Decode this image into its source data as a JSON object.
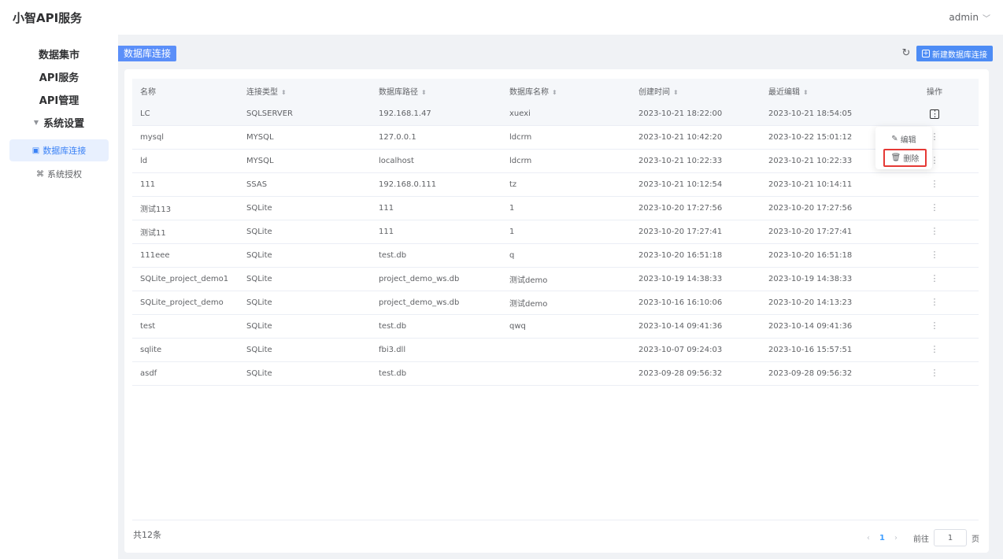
{
  "header": {
    "app_title": "小智API服务",
    "user": "admin",
    "user_chevron": "chevron-down-icon"
  },
  "sidebar": {
    "items": [
      {
        "label": "数据集市"
      },
      {
        "label": "API服务"
      },
      {
        "label": "API管理"
      },
      {
        "label": "系统设置"
      }
    ],
    "sub_items": [
      {
        "label": "数据库连接",
        "icon": "database-icon",
        "active": true
      },
      {
        "label": "系统授权",
        "icon": "authorize-icon",
        "active": false
      }
    ]
  },
  "page": {
    "title": "数据库连接",
    "new_button": "新建数据库连接"
  },
  "table": {
    "columns": [
      "名称",
      "连接类型",
      "数据库路径",
      "数据库名称",
      "创建时间",
      "最近编辑",
      "操作"
    ],
    "rows": [
      [
        "LC",
        "SQLSERVER",
        "192.168.1.47",
        "xuexi",
        "2023-10-21 18:22:00",
        "2023-10-21 18:54:05"
      ],
      [
        "mysql",
        "MYSQL",
        "127.0.0.1",
        "ldcrm",
        "2023-10-21 10:42:20",
        "2023-10-22 15:01:12"
      ],
      [
        "ld",
        "MYSQL",
        "localhost",
        "ldcrm",
        "2023-10-21 10:22:33",
        "2023-10-21 10:22:33"
      ],
      [
        "111",
        "SSAS",
        "192.168.0.111",
        "tz",
        "2023-10-21 10:12:54",
        "2023-10-21 10:14:11"
      ],
      [
        "测试113",
        "SQLite",
        "111",
        "1",
        "2023-10-20 17:27:56",
        "2023-10-20 17:27:56"
      ],
      [
        "测试11",
        "SQLite",
        "111",
        "1",
        "2023-10-20 17:27:41",
        "2023-10-20 17:27:41"
      ],
      [
        "111eee",
        "SQLite",
        "test.db",
        "q",
        "2023-10-20 16:51:18",
        "2023-10-20 16:51:18"
      ],
      [
        "SQLite_project_demo1",
        "SQLite",
        "project_demo_ws.db",
        "测试demo",
        "2023-10-19 14:38:33",
        "2023-10-19 14:38:33"
      ],
      [
        "SQLite_project_demo",
        "SQLite",
        "project_demo_ws.db",
        "测试demo",
        "2023-10-16 16:10:06",
        "2023-10-20 14:13:23"
      ],
      [
        "test",
        "SQLite",
        "test.db",
        "qwq",
        "2023-10-14 09:41:36",
        "2023-10-14 09:41:36"
      ],
      [
        "sqlite",
        "SQLite",
        "fbi3.dll",
        "",
        "2023-10-07 09:24:03",
        "2023-10-16 15:57:51"
      ],
      [
        "asdf",
        "SQLite",
        "test.db",
        "",
        "2023-09-28 09:56:32",
        "2023-09-28 09:56:32"
      ]
    ]
  },
  "dropdown": {
    "edit": "编辑",
    "delete": "删除"
  },
  "pagination": {
    "total": "共12条",
    "current_page": "1",
    "goto_label": "前往",
    "goto_value": "1",
    "page_suffix": "页"
  },
  "colors": {
    "primary": "#4d8cf5",
    "highlight_border": "#e53935",
    "active_bg": "#e8f0fe"
  }
}
